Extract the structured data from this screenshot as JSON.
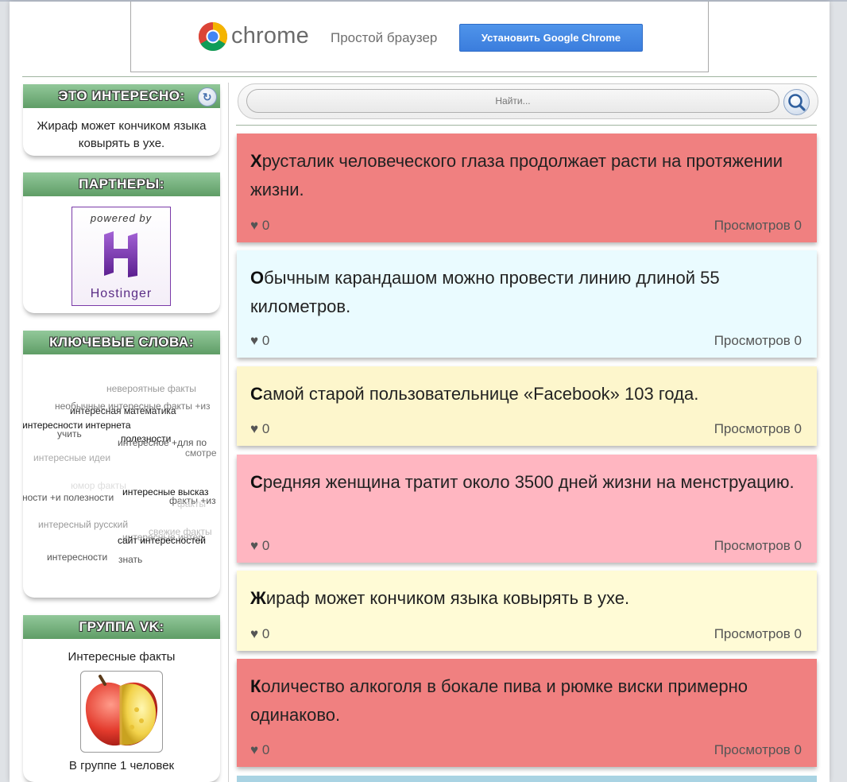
{
  "ad": {
    "brand": "chrome",
    "tagline": "Простой браузер",
    "install_label": "Установить Google Chrome"
  },
  "sidebar": {
    "fact_widget": {
      "title": "ЭТО ИНТЕРЕСНО:",
      "text": "Жираф может кончиком языка ковырять в ухе."
    },
    "partners_widget": {
      "title": "ПАРТНЕРЫ:",
      "powered_by": "powered by",
      "logo_text": "Hostinger"
    },
    "keywords_widget": {
      "title": "КЛЮЧЕВЫЕ СЛОВА:",
      "tags": [
        "невероятные факты",
        "необычные интересные факты +из",
        "интересная математика",
        "интересности интернета",
        "учить",
        "полезности",
        "интересное +для по",
        "смотре",
        "интересные идеи",
        "юмор факты",
        "интересные высказ",
        "ности +и полезности",
        "факты +из",
        "факты",
        "интересный русский",
        "свежие факты",
        "интересные интер",
        "сайт интересностей",
        "интересности",
        "знать"
      ]
    },
    "vk_widget": {
      "title": "ГРУППА VK:",
      "group_name": "Интересные факты",
      "member_count": "В группе 1 человек"
    }
  },
  "search": {
    "placeholder": "Найти..."
  },
  "facts": [
    {
      "first_letter": "Х",
      "rest": "русталик человеческого глаза продолжает расти на протяжении жизни.",
      "likes": "♥ 0",
      "views": "Просмотров 0",
      "color": "#f08080"
    },
    {
      "first_letter": "О",
      "rest": "бычным карандашом можно провести линию длиной 55 километров.",
      "likes": "♥ 0",
      "views": "Просмотров 0",
      "color": "#eafbff"
    },
    {
      "first_letter": "С",
      "rest": "амой старой пользовательнице «Facebook» 103 года.",
      "likes": "♥ 0",
      "views": "Просмотров 0",
      "color": "#fdf6cc"
    },
    {
      "first_letter": "С",
      "rest": "редняя женщина тратит около 3500 дней жизни на менструацию.",
      "likes": "♥ 0",
      "views": "Просмотров 0",
      "color": "#ffb6c1"
    },
    {
      "first_letter": "Ж",
      "rest": "ираф может кончиком языка ковырять в ухе.",
      "likes": "♥ 0",
      "views": "Просмотров 0",
      "color": "#fffbd6"
    },
    {
      "first_letter": "К",
      "rest": "оличество алкоголя в бокале пива и рюмке виски примерно одинаково.",
      "likes": "♥ 0",
      "views": "Просмотров 0",
      "color": "#f08080"
    }
  ],
  "colors": {
    "widget_header": "#7bb483",
    "accent_blue": "#3b7ddd",
    "next_card": "#a9d3e3"
  }
}
